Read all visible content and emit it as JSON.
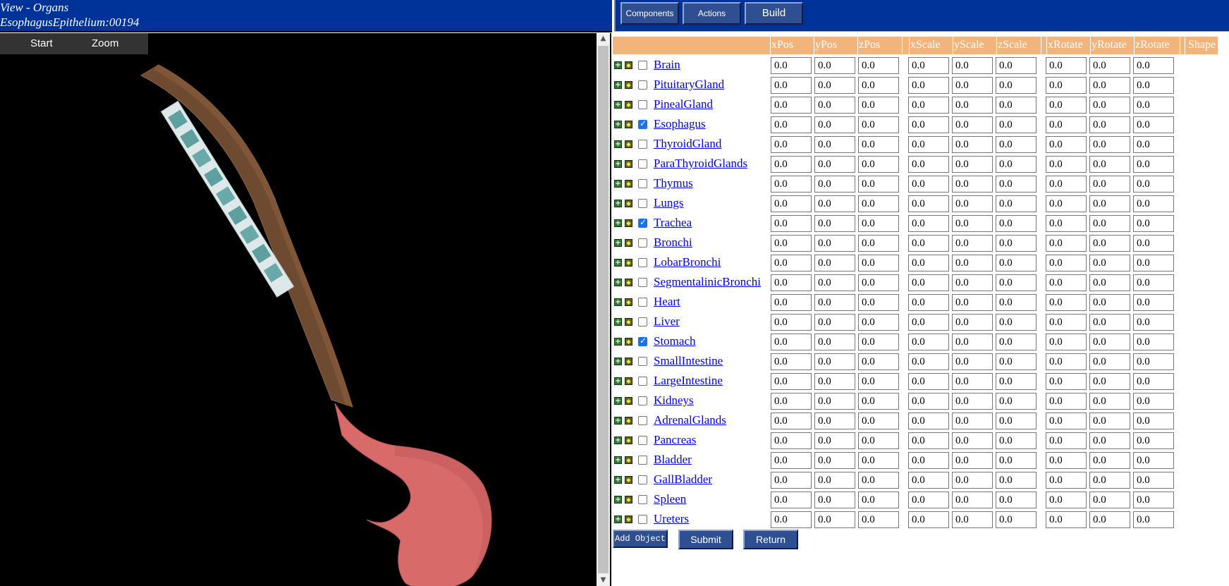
{
  "title": {
    "line1": "View - Organs",
    "line2": "EsophagusEpithelium:00194"
  },
  "toolbar": {
    "components": "Components",
    "actions": "Actions",
    "build": "Build"
  },
  "viewer": {
    "menu": [
      "Start",
      "Zoom"
    ]
  },
  "table": {
    "headers": [
      "xPos",
      "yPos",
      "zPos",
      "xScale",
      "yScale",
      "zScale",
      "xRotate",
      "yRotate",
      "zRotate",
      "Shape"
    ],
    "rows": [
      {
        "name": "Brain",
        "checked": false,
        "values": [
          "0.0",
          "0.0",
          "0.0",
          "0.0",
          "0.0",
          "0.0",
          "0.0",
          "0.0",
          "0.0"
        ]
      },
      {
        "name": "PituitaryGland",
        "checked": false,
        "values": [
          "0.0",
          "0.0",
          "0.0",
          "0.0",
          "0.0",
          "0.0",
          "0.0",
          "0.0",
          "0.0"
        ]
      },
      {
        "name": "PinealGland",
        "checked": false,
        "values": [
          "0.0",
          "0.0",
          "0.0",
          "0.0",
          "0.0",
          "0.0",
          "0.0",
          "0.0",
          "0.0"
        ]
      },
      {
        "name": "Esophagus",
        "checked": true,
        "values": [
          "0.0",
          "0.0",
          "0.0",
          "0.0",
          "0.0",
          "0.0",
          "0.0",
          "0.0",
          "0.0"
        ]
      },
      {
        "name": "ThyroidGland",
        "checked": false,
        "values": [
          "0.0",
          "0.0",
          "0.0",
          "0.0",
          "0.0",
          "0.0",
          "0.0",
          "0.0",
          "0.0"
        ]
      },
      {
        "name": "ParaThyroidGlands",
        "checked": false,
        "values": [
          "0.0",
          "0.0",
          "0.0",
          "0.0",
          "0.0",
          "0.0",
          "0.0",
          "0.0",
          "0.0"
        ]
      },
      {
        "name": "Thymus",
        "checked": false,
        "values": [
          "0.0",
          "0.0",
          "0.0",
          "0.0",
          "0.0",
          "0.0",
          "0.0",
          "0.0",
          "0.0"
        ]
      },
      {
        "name": "Lungs",
        "checked": false,
        "values": [
          "0.0",
          "0.0",
          "0.0",
          "0.0",
          "0.0",
          "0.0",
          "0.0",
          "0.0",
          "0.0"
        ]
      },
      {
        "name": "Trachea",
        "checked": true,
        "values": [
          "0.0",
          "0.0",
          "0.0",
          "0.0",
          "0.0",
          "0.0",
          "0.0",
          "0.0",
          "0.0"
        ]
      },
      {
        "name": "Bronchi",
        "checked": false,
        "values": [
          "0.0",
          "0.0",
          "0.0",
          "0.0",
          "0.0",
          "0.0",
          "0.0",
          "0.0",
          "0.0"
        ]
      },
      {
        "name": "LobarBronchi",
        "checked": false,
        "values": [
          "0.0",
          "0.0",
          "0.0",
          "0.0",
          "0.0",
          "0.0",
          "0.0",
          "0.0",
          "0.0"
        ]
      },
      {
        "name": "SegmentalinicBronchi",
        "checked": false,
        "values": [
          "0.0",
          "0.0",
          "0.0",
          "0.0",
          "0.0",
          "0.0",
          "0.0",
          "0.0",
          "0.0"
        ]
      },
      {
        "name": "Heart",
        "checked": false,
        "values": [
          "0.0",
          "0.0",
          "0.0",
          "0.0",
          "0.0",
          "0.0",
          "0.0",
          "0.0",
          "0.0"
        ]
      },
      {
        "name": "Liver",
        "checked": false,
        "values": [
          "0.0",
          "0.0",
          "0.0",
          "0.0",
          "0.0",
          "0.0",
          "0.0",
          "0.0",
          "0.0"
        ]
      },
      {
        "name": "Stomach",
        "checked": true,
        "values": [
          "0.0",
          "0.0",
          "0.0",
          "0.0",
          "0.0",
          "0.0",
          "0.0",
          "0.0",
          "0.0"
        ]
      },
      {
        "name": "SmallIntestine",
        "checked": false,
        "values": [
          "0.0",
          "0.0",
          "0.0",
          "0.0",
          "0.0",
          "0.0",
          "0.0",
          "0.0",
          "0.0"
        ]
      },
      {
        "name": "LargeIntestine",
        "checked": false,
        "values": [
          "0.0",
          "0.0",
          "0.0",
          "0.0",
          "0.0",
          "0.0",
          "0.0",
          "0.0",
          "0.0"
        ]
      },
      {
        "name": "Kidneys",
        "checked": false,
        "values": [
          "0.0",
          "0.0",
          "0.0",
          "0.0",
          "0.0",
          "0.0",
          "0.0",
          "0.0",
          "0.0"
        ]
      },
      {
        "name": "AdrenalGlands",
        "checked": false,
        "values": [
          "0.0",
          "0.0",
          "0.0",
          "0.0",
          "0.0",
          "0.0",
          "0.0",
          "0.0",
          "0.0"
        ]
      },
      {
        "name": "Pancreas",
        "checked": false,
        "values": [
          "0.0",
          "0.0",
          "0.0",
          "0.0",
          "0.0",
          "0.0",
          "0.0",
          "0.0",
          "0.0"
        ]
      },
      {
        "name": "Bladder",
        "checked": false,
        "values": [
          "0.0",
          "0.0",
          "0.0",
          "0.0",
          "0.0",
          "0.0",
          "0.0",
          "0.0",
          "0.0"
        ]
      },
      {
        "name": "GallBladder",
        "checked": false,
        "values": [
          "0.0",
          "0.0",
          "0.0",
          "0.0",
          "0.0",
          "0.0",
          "0.0",
          "0.0",
          "0.0"
        ]
      },
      {
        "name": "Spleen",
        "checked": false,
        "values": [
          "0.0",
          "0.0",
          "0.0",
          "0.0",
          "0.0",
          "0.0",
          "0.0",
          "0.0",
          "0.0"
        ]
      },
      {
        "name": "Ureters",
        "checked": false,
        "values": [
          "0.0",
          "0.0",
          "0.0",
          "0.0",
          "0.0",
          "0.0",
          "0.0",
          "0.0",
          "0.0"
        ]
      }
    ]
  },
  "buttons": {
    "add_object": "Add Object",
    "submit": "Submit",
    "return": "Return"
  },
  "icons": {
    "expand": "plus-square-icon",
    "edit": "green-tile-icon"
  },
  "colors": {
    "title_bar": "#003399",
    "header_bg": "#f2b47d",
    "link": "#0000ee",
    "esophagus": "#6e4a30",
    "trachea": "#7fb7b7",
    "stomach": "#d86a6a"
  }
}
